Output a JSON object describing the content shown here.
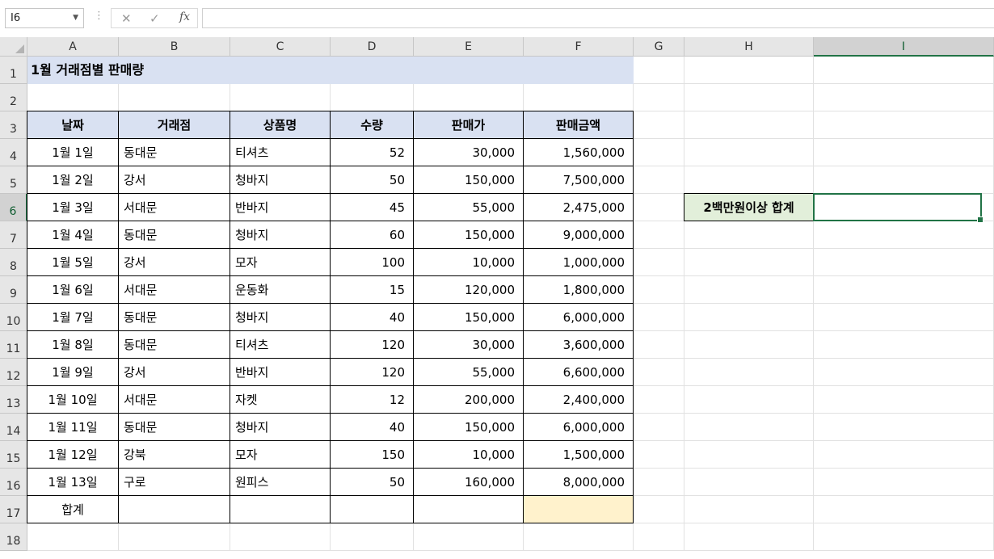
{
  "formula_bar": {
    "name_box": "I6",
    "cancel_icon": "✕",
    "enter_icon": "✓",
    "fx_label": "fx",
    "formula": ""
  },
  "columns": [
    "A",
    "B",
    "C",
    "D",
    "E",
    "F",
    "G",
    "H",
    "I"
  ],
  "rows": [
    "1",
    "2",
    "3",
    "4",
    "5",
    "6",
    "7",
    "8",
    "9",
    "10",
    "11",
    "12",
    "13",
    "14",
    "15",
    "16",
    "17",
    "18"
  ],
  "sheet": {
    "title": "1월 거래점별 판매량",
    "headers": [
      "날짜",
      "거래점",
      "상품명",
      "수량",
      "판매가",
      "판매금액"
    ],
    "records": [
      [
        "1월 1일",
        "동대문",
        "티셔츠",
        "52",
        "30,000",
        "1,560,000"
      ],
      [
        "1월 2일",
        "강서",
        "청바지",
        "50",
        "150,000",
        "7,500,000"
      ],
      [
        "1월 3일",
        "서대문",
        "반바지",
        "45",
        "55,000",
        "2,475,000"
      ],
      [
        "1월 4일",
        "동대문",
        "청바지",
        "60",
        "150,000",
        "9,000,000"
      ],
      [
        "1월 5일",
        "강서",
        "모자",
        "100",
        "10,000",
        "1,000,000"
      ],
      [
        "1월 6일",
        "서대문",
        "운동화",
        "15",
        "120,000",
        "1,800,000"
      ],
      [
        "1월 7일",
        "동대문",
        "청바지",
        "40",
        "150,000",
        "6,000,000"
      ],
      [
        "1월 8일",
        "동대문",
        "티셔츠",
        "120",
        "30,000",
        "3,600,000"
      ],
      [
        "1월 9일",
        "강서",
        "반바지",
        "120",
        "55,000",
        "6,600,000"
      ],
      [
        "1월 10일",
        "서대문",
        "자켓",
        "12",
        "200,000",
        "2,400,000"
      ],
      [
        "1월 11일",
        "동대문",
        "청바지",
        "40",
        "150,000",
        "6,000,000"
      ],
      [
        "1월 12일",
        "강북",
        "모자",
        "150",
        "10,000",
        "1,500,000"
      ],
      [
        "1월 13일",
        "구로",
        "원피스",
        "50",
        "160,000",
        "8,000,000"
      ]
    ],
    "total_label": "합계",
    "side_label": "2백만원이상 합계",
    "side_value": ""
  },
  "colors": {
    "header_fill": "#d9e1f2",
    "total_fill": "#fff2cc",
    "side_label_fill": "#e2efda",
    "selection": "#217346"
  }
}
